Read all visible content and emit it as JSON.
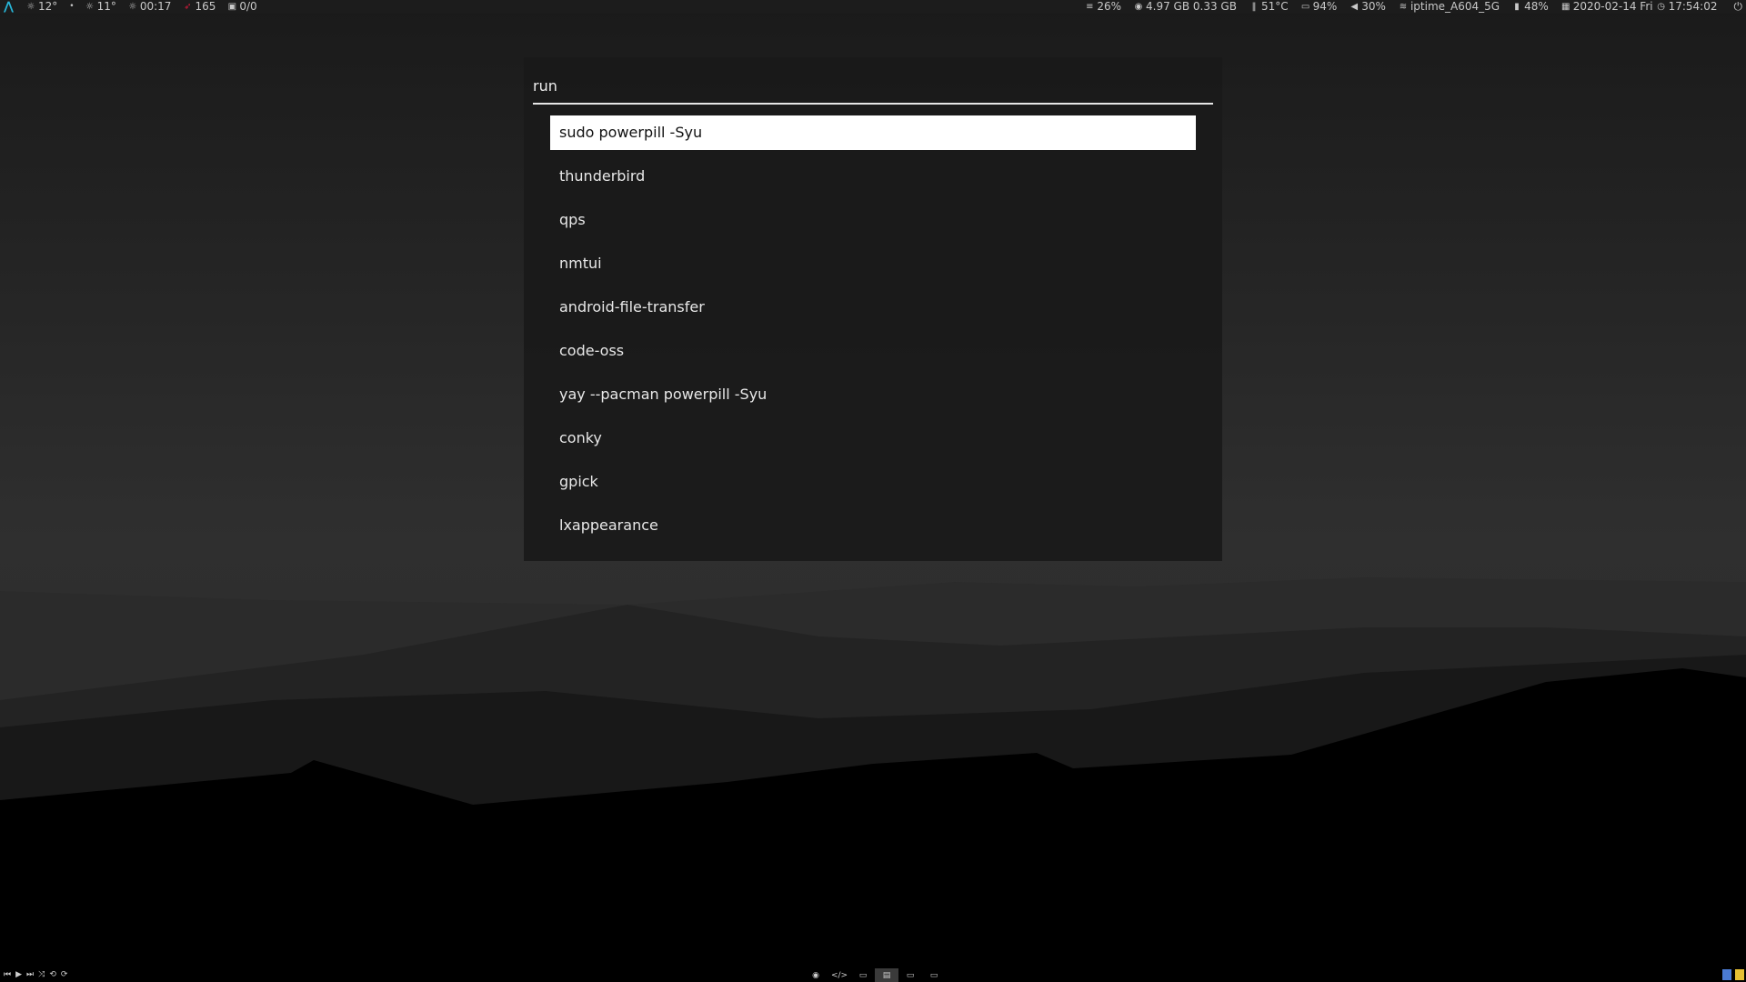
{
  "topbar": {
    "left": [
      {
        "icon": "sun-icon",
        "text": "12°"
      },
      {
        "icon": "dot-icon",
        "text": ""
      },
      {
        "icon": "sun-icon",
        "text": "11°"
      },
      {
        "icon": "sun-icon",
        "text": "00:17"
      },
      {
        "icon": "arch-updates-icon",
        "text": "165"
      },
      {
        "icon": "package-icon",
        "text": "0/0"
      }
    ],
    "right": [
      {
        "icon": "disk-icon",
        "text": "26%"
      },
      {
        "icon": "memory-icon",
        "text": "4.97 GB 0.33 GB"
      },
      {
        "icon": "thermometer-icon",
        "text": "51°C"
      },
      {
        "icon": "cpu-icon",
        "text": "94%"
      },
      {
        "icon": "volume-icon",
        "text": "30%"
      },
      {
        "icon": "wifi-icon",
        "text": "iptime_A604_5G"
      },
      {
        "icon": "battery-icon",
        "text": "48%"
      },
      {
        "icon": "calendar-icon",
        "text": "2020-02-14 Fri"
      },
      {
        "icon": "clock-icon",
        "text": "17:54:02"
      }
    ]
  },
  "launcher": {
    "input_value": "run",
    "results": [
      "sudo powerpill -Syu",
      "thunderbird",
      "qps",
      "nmtui",
      "android-file-transfer",
      "code-oss",
      "yay --pacman powerpill -Syu",
      "conky",
      "gpick",
      "lxappearance"
    ],
    "selected_index": 0
  },
  "bottombar": {
    "media": [
      "prev-icon",
      "play-icon",
      "next-icon",
      "shuffle-icon",
      "repeat-icon",
      "repeat-one-icon"
    ],
    "workspaces": [
      "browser-icon",
      "code-icon",
      "terminal-icon",
      "document-icon",
      "monitor-icon",
      "monitor-icon"
    ],
    "active_workspace": 3
  },
  "colors": {
    "accent": "#27b6d8",
    "arch_red": "#d01a3a",
    "selected_bg": "#ffffff"
  }
}
